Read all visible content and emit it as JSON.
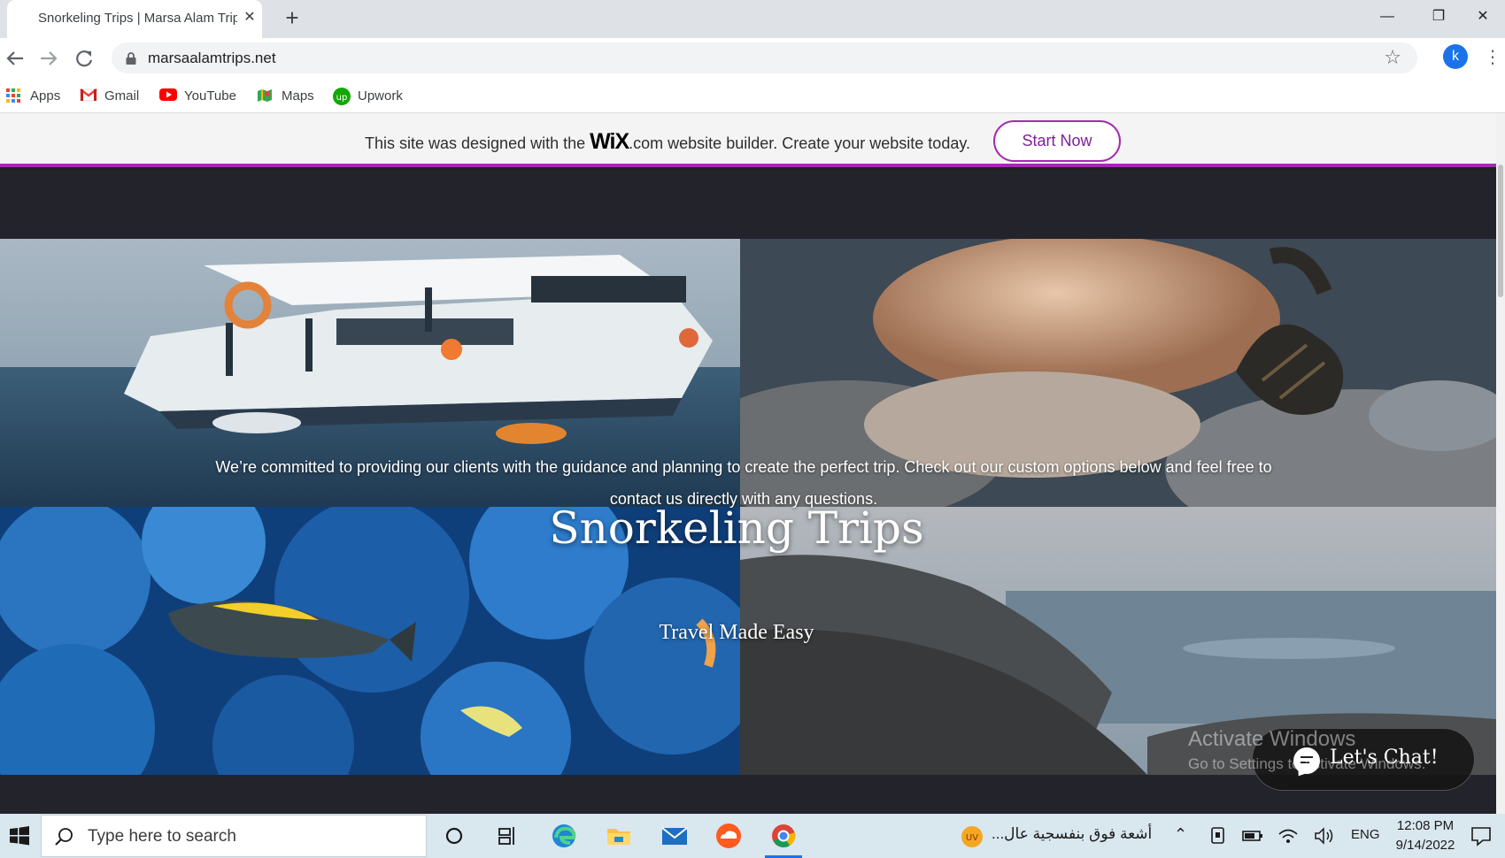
{
  "browser": {
    "tab_title": "Snorkeling Trips | Marsa Alam Trips",
    "tab_close": "✕",
    "new_tab": "+",
    "window_controls": {
      "minimize": "—",
      "restore": "❐",
      "close": "✕"
    },
    "url": "marsaalamtrips.net",
    "profile_initial": "k",
    "bookmarks": [
      {
        "label": "Apps",
        "icon": "apps-grid-icon"
      },
      {
        "label": "Gmail",
        "icon": "gmail-icon"
      },
      {
        "label": "YouTube",
        "icon": "youtube-icon"
      },
      {
        "label": "Maps",
        "icon": "maps-icon"
      },
      {
        "label": "Upwork",
        "icon": "upwork-icon"
      }
    ]
  },
  "wix_banner": {
    "text_before": "This site was designed with the ",
    "logo": "WiX",
    "dotcom": ".com",
    "text_after": " website builder. Create your website today.",
    "button": "Start Now",
    "accent_color": "#a429b2"
  },
  "hero": {
    "title": "Snorkeling Trips",
    "subtitle": "Travel Made Easy",
    "body": "We’re committed to providing our clients with the guidance and planning to create the perfect trip. Check out our custom options below and feel free to contact us directly with any questions."
  },
  "chat": {
    "label": "Let's Chat!"
  },
  "watermark": {
    "title": "Activate Windows",
    "subtitle": "Go to Settings to activate Windows."
  },
  "taskbar": {
    "search_placeholder": "Type here to search",
    "news": "أشعة فوق بنفسجية عال...",
    "language": "ENG",
    "time": "12:08 PM",
    "date": "9/14/2022"
  }
}
